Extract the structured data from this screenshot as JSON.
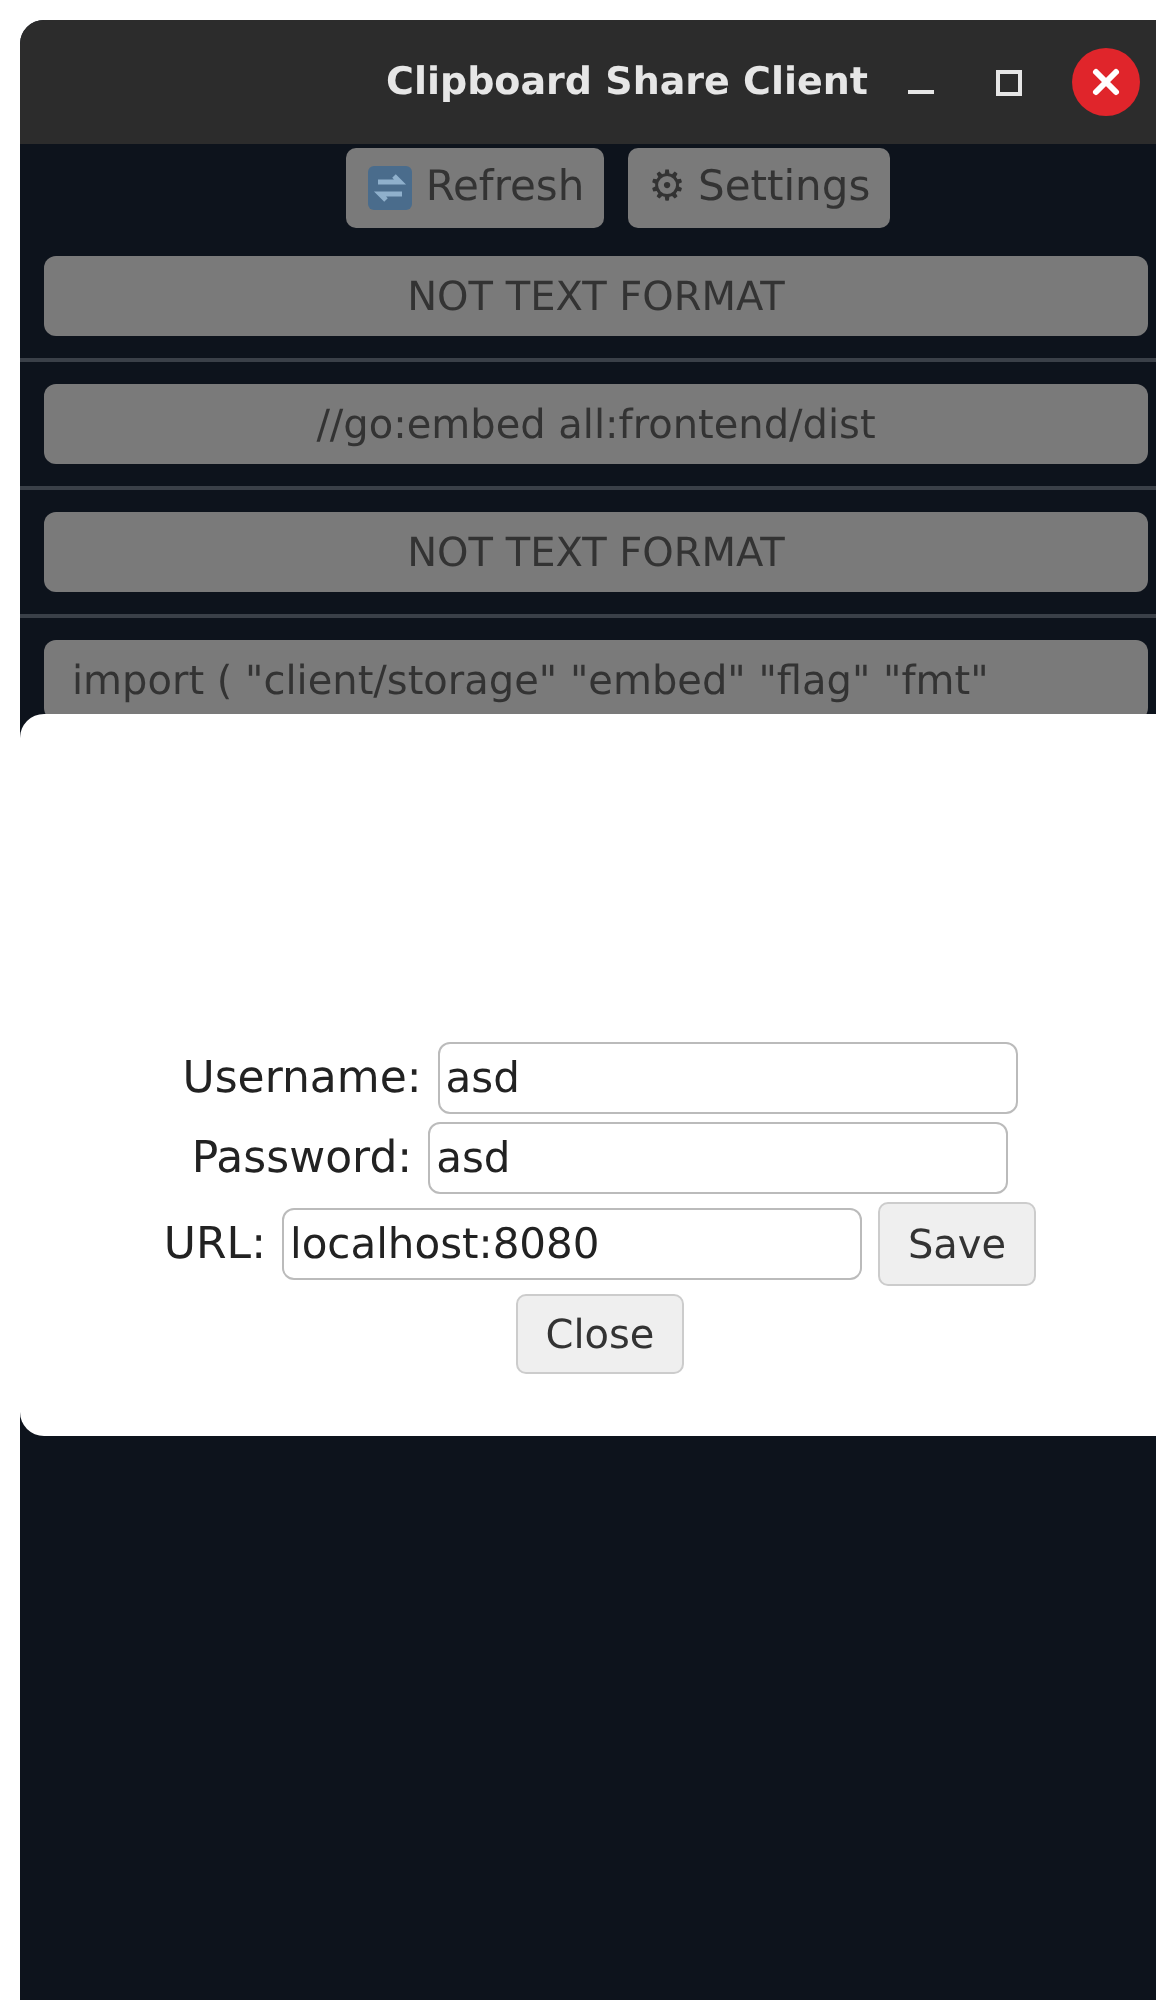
{
  "window": {
    "title": "Clipboard Share Client"
  },
  "toolbar": [
    {
      "kind": "refresh",
      "label": "Refresh"
    },
    {
      "kind": "settings",
      "icon": "⚙",
      "label": "Settings"
    }
  ],
  "clips": [
    "NOT TEXT FORMAT",
    "//go:embed all:frontend/dist",
    "NOT TEXT FORMAT",
    "import ( \"client/storage\" \"embed\" \"flag\" \"fmt\""
  ],
  "settings_dialog": {
    "fields": [
      {
        "label": "Username:",
        "value": "asd"
      },
      {
        "label": "Password:",
        "value": "asd"
      },
      {
        "label": "URL:",
        "value": "localhost:8080",
        "button": "Save"
      }
    ],
    "close": "Close"
  }
}
